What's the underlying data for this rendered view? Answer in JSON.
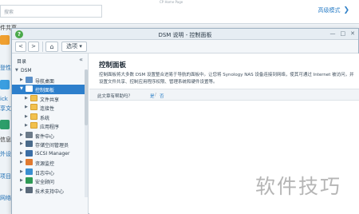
{
  "background": {
    "top_caption": "CP Home Page",
    "search_placeholder": "搜索",
    "advanced_mode": "高级模式",
    "left_labels": [
      "件共享",
      "登性",
      "ick",
      "享文件",
      "信息",
      "外设",
      "项目",
      "网络"
    ]
  },
  "window": {
    "title": "DSM 说明 - 控制面板",
    "help_badge": "?",
    "controls": [
      "—",
      "□",
      "✕"
    ]
  },
  "toolbar": {
    "back": "<",
    "forward": ">",
    "home": "⌂",
    "options": "选项 ▾"
  },
  "sidebar": {
    "header": "目录",
    "collapse": "«",
    "tree": [
      {
        "label": "DSM",
        "depth": 0,
        "arrow": "▼",
        "icon": "none",
        "selected": false
      },
      {
        "label": "导航桌面",
        "depth": 1,
        "arrow": "▶",
        "icon": "desktop-icon",
        "selected": false
      },
      {
        "label": "控制面板",
        "depth": 1,
        "arrow": "▼",
        "icon": "control-panel-icon",
        "selected": true
      },
      {
        "label": "文件共享",
        "depth": 2,
        "arrow": "▶",
        "icon": "folder-icon",
        "selected": false
      },
      {
        "label": "连接性",
        "depth": 2,
        "arrow": "▶",
        "icon": "folder-icon",
        "selected": false
      },
      {
        "label": "系统",
        "depth": 2,
        "arrow": "▶",
        "icon": "folder-icon",
        "selected": false
      },
      {
        "label": "应用程序",
        "depth": 2,
        "arrow": "▶",
        "icon": "folder-icon",
        "selected": false
      },
      {
        "label": "套件中心",
        "depth": 1,
        "arrow": "▶",
        "icon": "package-icon",
        "selected": false
      },
      {
        "label": "存储空间管理员",
        "depth": 1,
        "arrow": "▶",
        "icon": "storage-icon",
        "selected": false
      },
      {
        "label": "iSCSI Manager",
        "depth": 1,
        "arrow": "▶",
        "icon": "iscsi-icon",
        "selected": false
      },
      {
        "label": "资源监控",
        "depth": 1,
        "arrow": "▶",
        "icon": "monitor-icon",
        "selected": false
      },
      {
        "label": "日志中心",
        "depth": 1,
        "arrow": "▶",
        "icon": "log-icon",
        "selected": false
      },
      {
        "label": "安全顾问",
        "depth": 1,
        "arrow": "▶",
        "icon": "security-icon",
        "selected": false
      },
      {
        "label": "技术支持中心",
        "depth": 1,
        "arrow": "▶",
        "icon": "support-icon",
        "selected": false
      }
    ]
  },
  "content": {
    "title": "控制面板",
    "description": "控制面板将大多数 DSM 设置整合进易于导航的面板中。让您将 Synology NAS 设备连接到网络，使其可通过 Internet 被访问，并设置文件共享、控制应用程序权限、管理系统和硬件设置等。",
    "help_question": "此文章有帮助吗？",
    "help_yes": "是",
    "help_sep": "/",
    "help_no": "否"
  },
  "watermark": "软件技巧",
  "colors": {
    "selected": "#2d7fcc",
    "link": "#2f80c8",
    "help_badge": "#4aa94a"
  }
}
